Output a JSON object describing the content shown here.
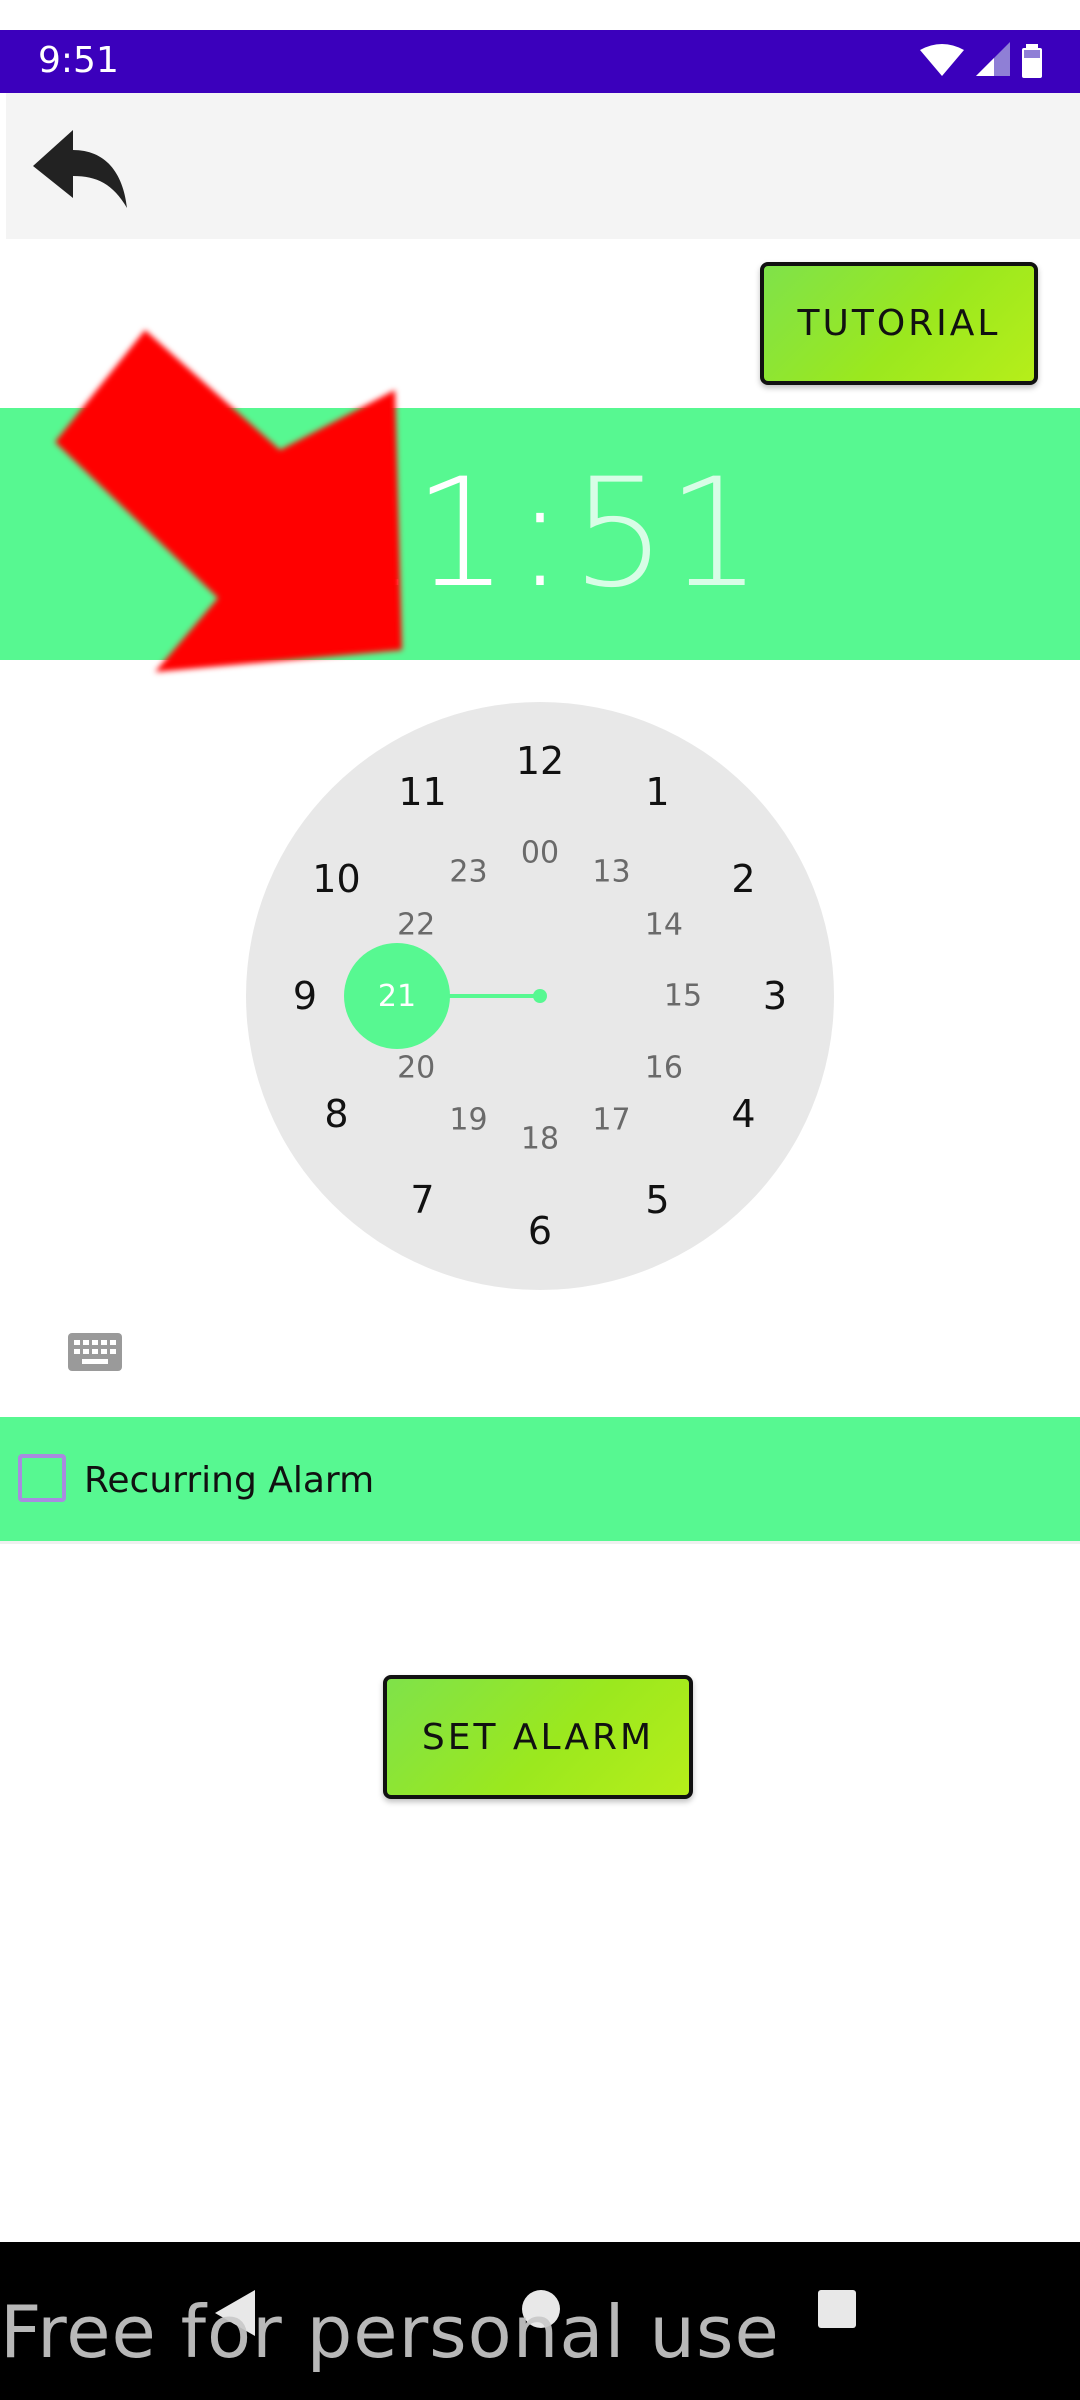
{
  "status_bar": {
    "time": "9:51",
    "icons": [
      "wifi-icon",
      "signal-icon",
      "battery-icon"
    ],
    "color": "#3B00BC"
  },
  "app_bar": {
    "back_icon": "back-arrow-icon"
  },
  "tutorial_button": {
    "label": "TUTORIAL"
  },
  "time_display": {
    "hour": "21",
    "separator": ":",
    "minute": "51",
    "background": "#57F891"
  },
  "overlay": {
    "icon": "red-arrow-icon",
    "color": "#ff0000"
  },
  "clock": {
    "outer_numbers": [
      "12",
      "1",
      "2",
      "3",
      "4",
      "5",
      "6",
      "7",
      "8",
      "9",
      "10",
      "11"
    ],
    "inner_numbers": [
      "00",
      "13",
      "14",
      "15",
      "16",
      "17",
      "18",
      "19",
      "20",
      "21",
      "22",
      "23"
    ],
    "selected": "21",
    "accent": "#57F891"
  },
  "keyboard_toggle": {
    "icon": "keyboard-icon"
  },
  "recurring": {
    "label": "Recurring Alarm",
    "checked": false
  },
  "set_alarm_button": {
    "label": "SET ALARM"
  },
  "nav_bar": {
    "icons": [
      "nav-back-icon",
      "nav-home-icon",
      "nav-recents-icon"
    ]
  },
  "watermark": {
    "text": "Free for personal use"
  }
}
